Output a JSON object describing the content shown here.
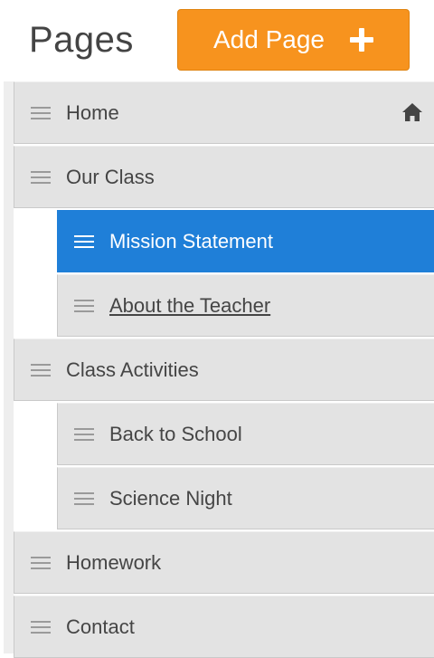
{
  "header": {
    "title": "Pages",
    "add_button_label": "Add Page",
    "add_icon": "plus-icon",
    "accent_color": "#f7931e"
  },
  "pages": {
    "selected_color": "#1f7fd8",
    "items": [
      {
        "label": "Home",
        "level": 0,
        "icon": "home-icon"
      },
      {
        "label": "Our Class",
        "level": 0
      },
      {
        "label": "Mission Statement",
        "level": 1,
        "selected": true
      },
      {
        "label": "About the Teacher",
        "level": 1,
        "underlined": true
      },
      {
        "label": "Class Activities",
        "level": 0
      },
      {
        "label": "Back to School",
        "level": 1
      },
      {
        "label": "Science Night",
        "level": 1
      },
      {
        "label": "Homework",
        "level": 0
      },
      {
        "label": "Contact",
        "level": 0
      }
    ]
  }
}
